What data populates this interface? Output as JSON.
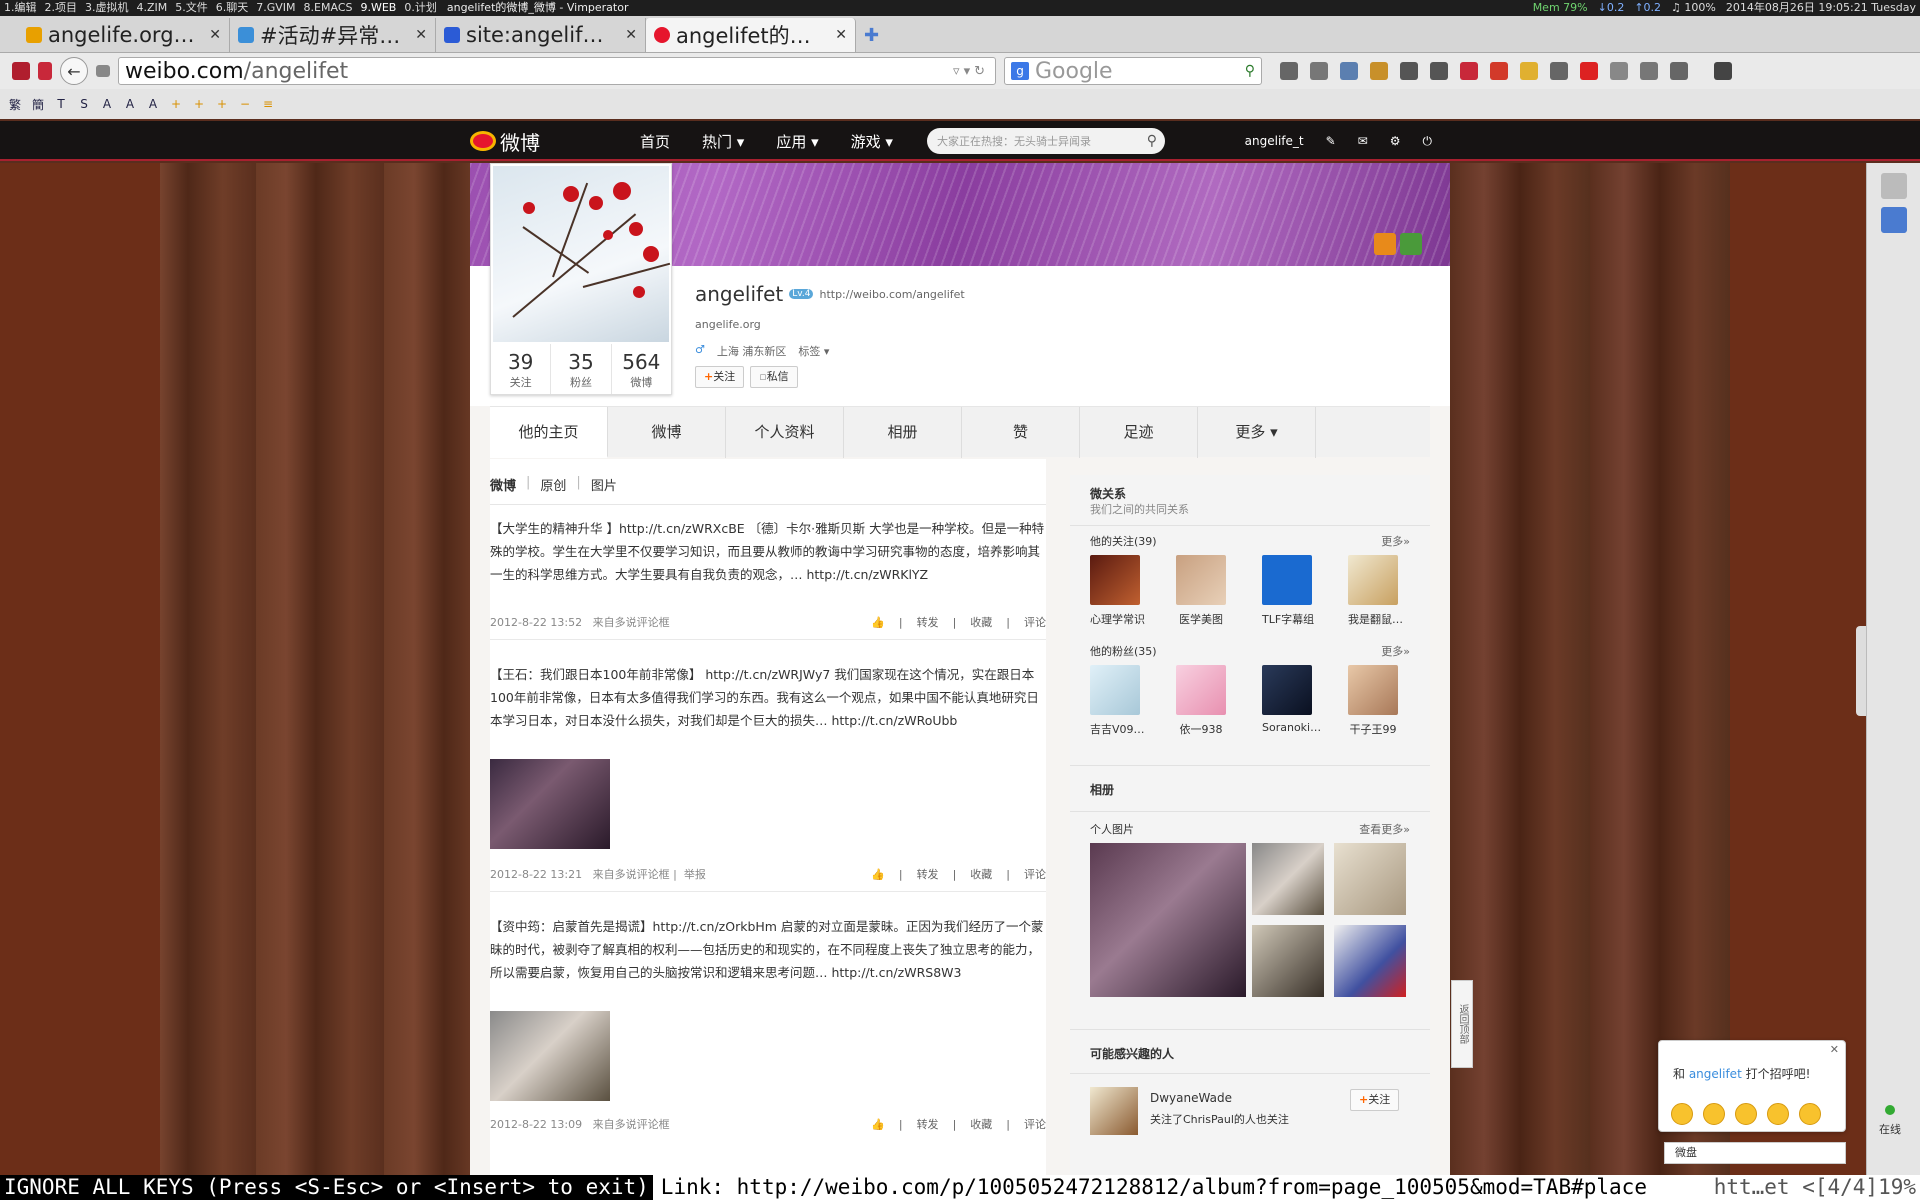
{
  "wm": {
    "workspaces": [
      "1.编辑",
      "2.项目",
      "3.虚拟机",
      "4.ZIM",
      "5.文件",
      "6.聊天",
      "7.GVIM",
      "8.EMACS",
      "9.WEB",
      "0.计划"
    ],
    "title": "angelifet的微博_微博 - Vimperator",
    "mem": "Mem 79%",
    "net_down": "↓0.2",
    "net_up": "↑0.2",
    "vol": "♫ 100%",
    "datetime": "2014年08月26日 19:05:21 Tuesday"
  },
  "tabs": [
    {
      "title": "angelife.org…",
      "color": "#e8a000"
    },
    {
      "title": "#活动#异常…",
      "color": "#3b8fd8"
    },
    {
      "title": "site:angelif…",
      "color": "#2b5bd6"
    },
    {
      "title": "angelifet的…",
      "color": "#e6162d"
    }
  ],
  "nav": {
    "url_domain": "weibo.com",
    "url_path": "/angelifet",
    "search_placeholder": "Google"
  },
  "bookmarks": [
    "繁",
    "簡",
    "T",
    "S",
    "A",
    "A",
    "A",
    "+",
    "+",
    "+",
    "−",
    "≡"
  ],
  "weibo": {
    "logo": "微博",
    "nav": [
      "首页",
      "热门 ▾",
      "应用 ▾",
      "游戏 ▾"
    ],
    "search_placeholder": "大家正在热搜：无头骑士异闻录",
    "user": "angelife_t"
  },
  "profile": {
    "name": "angelifet",
    "level": "Lv.4",
    "link": "http://weibo.com/angelifet",
    "domain": "angelife.org",
    "gender": "♂",
    "location": "上海 浦东新区",
    "tag_label": "标签 ▾",
    "follow_btn": "关注",
    "msg_btn": "私信",
    "stats": [
      {
        "n": "39",
        "l": "关注"
      },
      {
        "n": "35",
        "l": "粉丝"
      },
      {
        "n": "564",
        "l": "微博"
      }
    ]
  },
  "ptabs": [
    "他的主页",
    "微博",
    "个人资料",
    "相册",
    "赞",
    "足迹",
    "更多 ▾"
  ],
  "feed_tabs": [
    "微博",
    "原创",
    "图片"
  ],
  "posts": [
    {
      "text": "【大学生的精神升华 】http://t.cn/zWRXcBE 〔德〕卡尔·雅斯贝斯 大学也是一种学校。但是一种特殊的学校。学生在大学里不仅要学习知识，而且要从教师的教诲中学习研究事物的态度，培养影响其一生的科学思维方式。大学生要具有自我负责的观念，… http://t.cn/zWRKlYZ",
      "time": "2012-8-22 13:52",
      "source": "来自多说评论框",
      "report": ""
    },
    {
      "text": "【王石：我们跟日本100年前非常像】 http://t.cn/zWRJWy7 我们国家现在这个情况，实在跟日本100年前非常像，日本有太多值得我们学习的东西。我有这么一个观点，如果中国不能认真地研究日本学习日本，对日本没什么损失，对我们却是个巨大的损失… http://t.cn/zWRoUbb",
      "time": "2012-8-22 13:21",
      "source": "来自多说评论框",
      "report": "举报"
    },
    {
      "text": "【资中筠：启蒙首先是揭谎】http://t.cn/zOrkbHm 启蒙的对立面是蒙昧。正因为我们经历了一个蒙昧的时代，被剥夺了解真相的权利——包括历史的和现实的，在不同程度上丧失了独立思考的能力，所以需要启蒙，恢复用自己的头脑按常识和逻辑来思考问题… http://t.cn/zWRS8W3",
      "time": "2012-8-22 13:09",
      "source": "来自多说评论框",
      "report": ""
    }
  ],
  "post_actions": [
    "转发",
    "收藏",
    "评论"
  ],
  "side": {
    "rel_title": "微关系",
    "rel_sub": "我们之间的共同关系",
    "follows_title": "他的关注(39)",
    "fans_title": "他的粉丝(35)",
    "more": "更多»",
    "follows": [
      "心理学常识",
      "医学美图",
      "TLF字幕组",
      "我是翻鼠…"
    ],
    "fans": [
      "吉吉V09…",
      "依一938",
      "Soranoki…",
      "干子王99"
    ],
    "album_title": "相册",
    "album_sub": "个人图片",
    "album_more": "查看更多»",
    "interest_title": "可能感兴趣的人",
    "suggest_name": "DwyaneWade",
    "suggest_desc": "关注了ChrisPaul的人也关注",
    "suggest_btn": "关注"
  },
  "greet": {
    "pre": "和 ",
    "name": "angelifet",
    "post": " 打个招呼吧!"
  },
  "wpan": "微盘",
  "backtop": "返回顶部",
  "online": "在线",
  "status": {
    "mode": "IGNORE ALL KEYS (Press <S-Esc> or <Insert> to exit)",
    "link": "Link: http://weibo.com/p/1005052472128812/album?from=page_100505&mod=TAB#place",
    "pos": "htt…et <[4/4]19%"
  }
}
